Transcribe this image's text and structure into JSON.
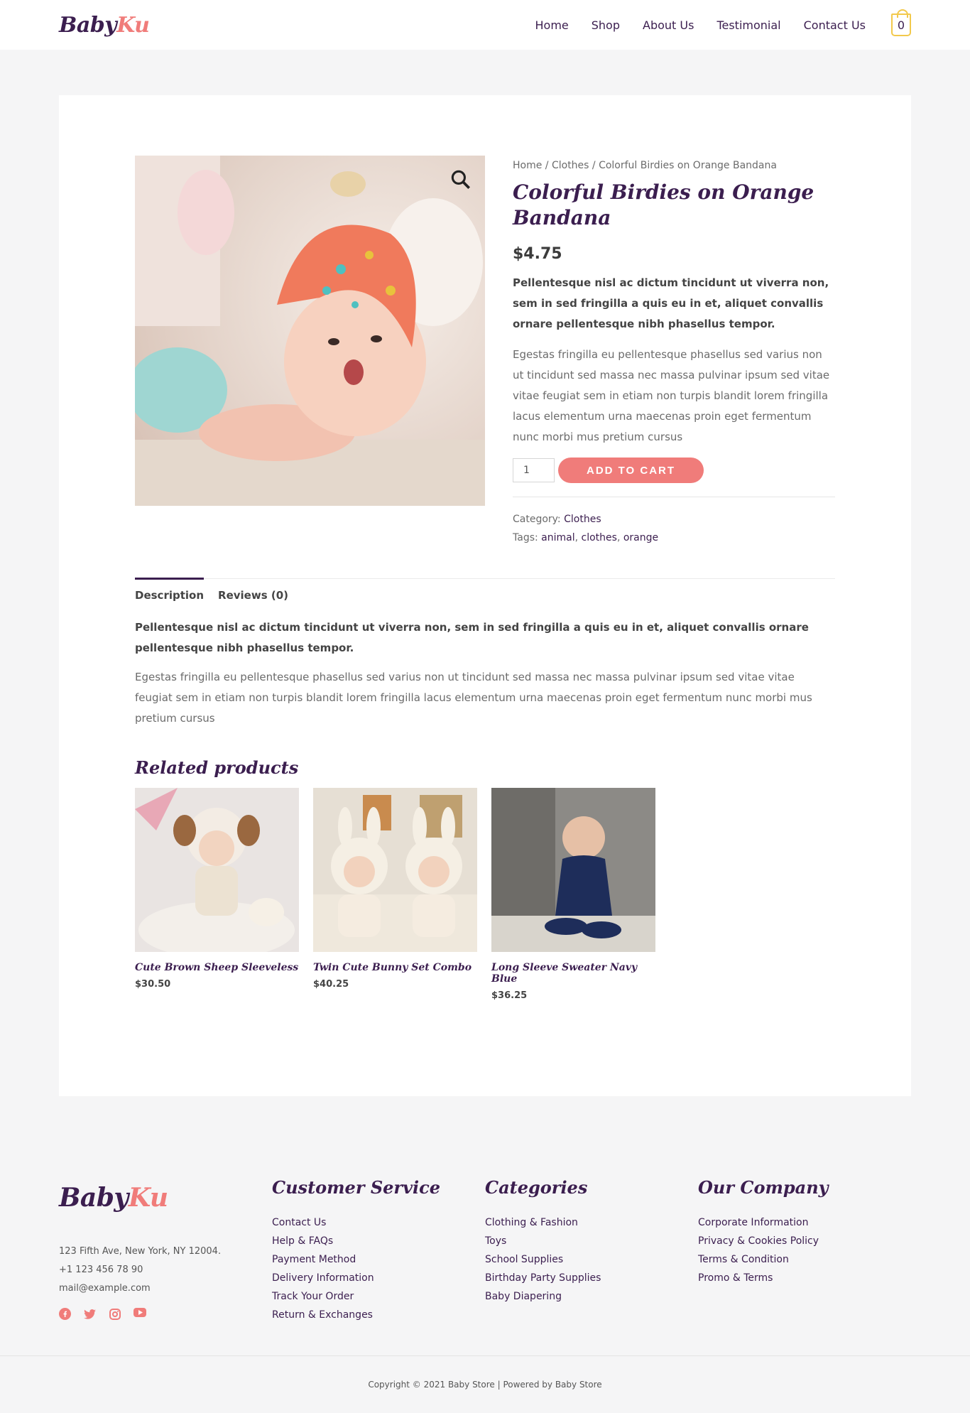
{
  "header": {
    "logo_part1": "Baby",
    "logo_part2": "Ku",
    "nav": [
      "Home",
      "Shop",
      "About Us",
      "Testimonial",
      "Contact Us"
    ],
    "cart_count": "0"
  },
  "product": {
    "breadcrumb": "Home / Clothes / Colorful Birdies on Orange Bandana",
    "title": "Colorful Birdies on Orange Bandana",
    "price": "$4.75",
    "short_bold": "Pellentesque nisl ac dictum tincidunt ut viverra non, sem in sed fringilla a quis eu in et, aliquet convallis ornare pellentesque nibh phasellus tempor.",
    "short_desc": "Egestas fringilla eu pellentesque phasellus sed varius non ut tincidunt sed massa nec massa pulvinar ipsum sed vitae vitae feugiat sem in etiam non turpis blandit lorem fringilla lacus elementum urna maecenas proin eget fermentum nunc morbi mus pretium cursus",
    "qty": "1",
    "add_to_cart": "ADD TO CART",
    "category_label": "Category:",
    "category": "Clothes",
    "tags_label": "Tags:",
    "tags": [
      "animal",
      "clothes",
      "orange"
    ]
  },
  "tabs": {
    "description": "Description",
    "reviews": "Reviews (0)"
  },
  "description": {
    "bold": "Pellentesque nisl ac dictum tincidunt ut viverra non, sem in sed fringilla a quis eu in et, aliquet convallis ornare pellentesque nibh phasellus tempor.",
    "text": "Egestas fringilla eu pellentesque phasellus sed varius non ut tincidunt sed massa nec massa pulvinar ipsum sed vitae vitae feugiat sem in etiam non turpis blandit lorem fringilla lacus elementum urna maecenas proin eget fermentum nunc morbi mus pretium cursus"
  },
  "related": {
    "title": "Related products",
    "items": [
      {
        "name": "Cute Brown Sheep Sleeveless",
        "price": "$30.50"
      },
      {
        "name": "Twin Cute Bunny Set Combo",
        "price": "$40.25"
      },
      {
        "name": "Long Sleeve Sweater Navy Blue",
        "price": "$36.25"
      }
    ]
  },
  "footer": {
    "address": "123 Fifth Ave, New York, NY 12004.",
    "phone": "+1 123 456 78 90",
    "email": "mail@example.com",
    "social_icons": [
      "facebook-icon",
      "twitter-icon",
      "instagram-icon",
      "youtube-icon"
    ],
    "customer_service": {
      "title": "Customer Service",
      "links": [
        "Contact Us",
        "Help & FAQs",
        "Payment Method",
        "Delivery Information",
        "Track Your Order",
        "Return & Exchanges"
      ]
    },
    "categories": {
      "title": "Categories",
      "links": [
        "Clothing & Fashion",
        "Toys",
        "School Supplies",
        "Birthday Party Supplies",
        "Baby Diapering"
      ]
    },
    "company": {
      "title": "Our Company",
      "links": [
        "Corporate Information",
        "Privacy & Cookies Policy",
        "Terms & Condition",
        "Promo & Terms"
      ]
    },
    "copyright": "Copyright © 2021 Baby Store | Powered by Baby Store"
  },
  "colors": {
    "brand_dark": "#3b1e4f",
    "accent": "#f07c7a",
    "cart_icon": "#f2c94c"
  }
}
